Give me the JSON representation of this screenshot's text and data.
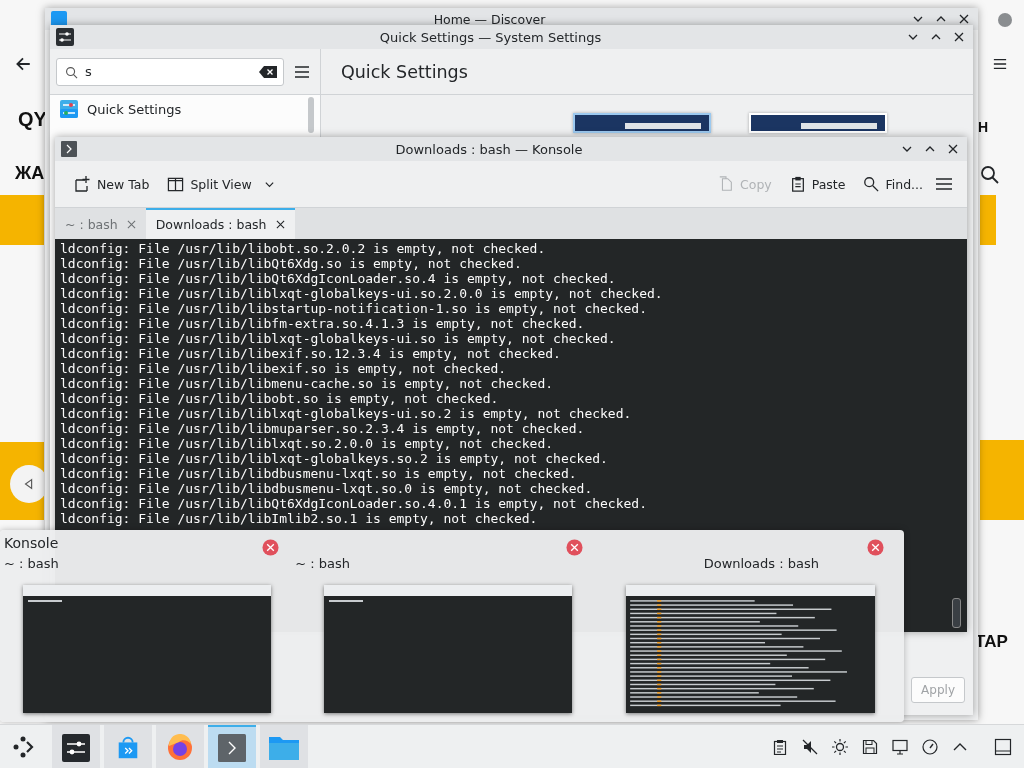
{
  "background": {
    "labels": [
      "QY",
      "ЖА",
      "Н",
      "ТАР"
    ]
  },
  "discover": {
    "title": "Home — Discover"
  },
  "settings": {
    "title": "Quick Settings — System Settings",
    "search": {
      "value": "s"
    },
    "heading": "Quick Settings",
    "sidebar": {
      "items": [
        {
          "label": "Quick Settings"
        }
      ]
    },
    "apply_button": {
      "label": "Apply",
      "disabled": true
    }
  },
  "konsole": {
    "title": "Downloads : bash — Konsole",
    "toolbar": [
      {
        "kind": "new-tab",
        "label": "New Tab",
        "disabled": false
      },
      {
        "kind": "split",
        "label": "Split View",
        "disabled": false
      },
      {
        "kind": "copy",
        "label": "Copy",
        "disabled": true
      },
      {
        "kind": "paste",
        "label": "Paste",
        "disabled": false
      },
      {
        "kind": "find",
        "label": "Find...",
        "disabled": false
      }
    ],
    "tabs": [
      {
        "label": "~ : bash",
        "selected": false
      },
      {
        "label": "Downloads : bash",
        "selected": true
      }
    ],
    "lines": [
      "ldconfig: File /usr/lib/libobt.so.2.0.2 is empty, not checked.",
      "ldconfig: File /usr/lib/libQt6Xdg.so is empty, not checked.",
      "ldconfig: File /usr/lib/libQt6XdgIconLoader.so.4 is empty, not checked.",
      "ldconfig: File /usr/lib/liblxqt-globalkeys-ui.so.2.0.0 is empty, not checked.",
      "ldconfig: File /usr/lib/libstartup-notification-1.so is empty, not checked.",
      "ldconfig: File /usr/lib/libfm-extra.so.4.1.3 is empty, not checked.",
      "ldconfig: File /usr/lib/liblxqt-globalkeys-ui.so is empty, not checked.",
      "ldconfig: File /usr/lib/libexif.so.12.3.4 is empty, not checked.",
      "ldconfig: File /usr/lib/libexif.so is empty, not checked.",
      "ldconfig: File /usr/lib/libmenu-cache.so is empty, not checked.",
      "ldconfig: File /usr/lib/libobt.so is empty, not checked.",
      "ldconfig: File /usr/lib/liblxqt-globalkeys-ui.so.2 is empty, not checked.",
      "ldconfig: File /usr/lib/libmuparser.so.2.3.4 is empty, not checked.",
      "ldconfig: File /usr/lib/liblxqt.so.2.0.0 is empty, not checked.",
      "ldconfig: File /usr/lib/liblxqt-globalkeys.so.2 is empty, not checked.",
      "ldconfig: File /usr/lib/libdbusmenu-lxqt.so is empty, not checked.",
      "ldconfig: File /usr/lib/libdbusmenu-lxqt.so.0 is empty, not checked.",
      "ldconfig: File /usr/lib/libQt6XdgIconLoader.so.4.0.1 is empty, not checked.",
      "ldconfig: File /usr/lib/libImlib2.so.1 is empty, not checked."
    ]
  },
  "switcher": {
    "app": "Konsole",
    "windows": [
      {
        "caption": "~ : bash",
        "kind": "empty"
      },
      {
        "caption": "~ : bash",
        "kind": "empty"
      },
      {
        "caption": "Downloads : bash",
        "kind": "output"
      }
    ]
  },
  "taskbar": {
    "tasks": [
      {
        "kind": "settings",
        "active": false
      },
      {
        "kind": "discover",
        "active": false
      },
      {
        "kind": "browser",
        "active": false
      },
      {
        "kind": "terminal",
        "active": true
      },
      {
        "kind": "files",
        "active": false
      }
    ]
  }
}
